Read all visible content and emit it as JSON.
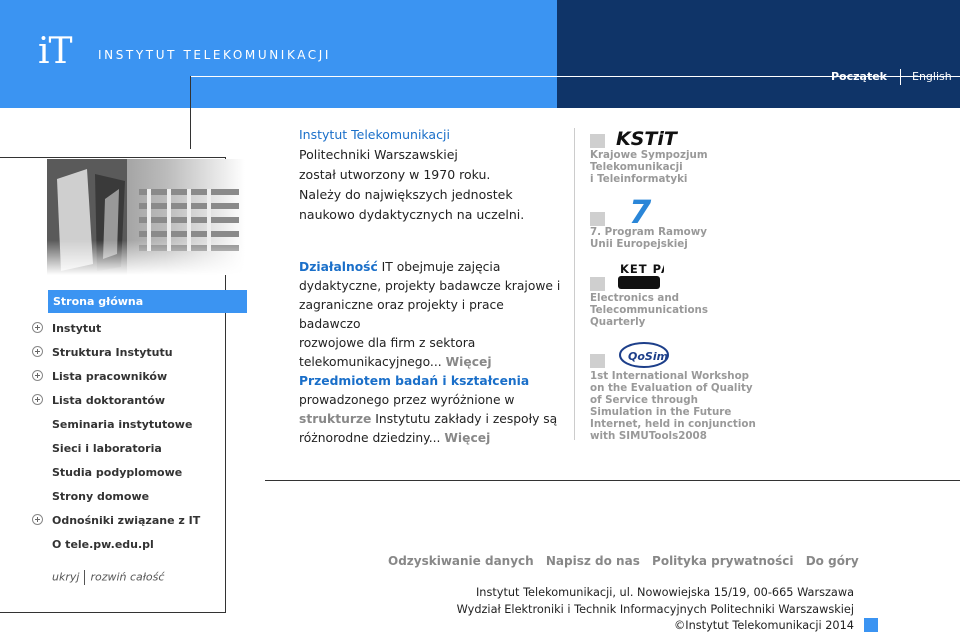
{
  "header": {
    "logo_mark": "iT",
    "logo_text": "INSTYTUT TELEKOMUNIKACJI",
    "nav_active": "Początek",
    "nav_english": "English",
    "colors": {
      "header_blue": "#3b94f2",
      "header_navy": "#0f3468"
    }
  },
  "sidebar": {
    "active": "Strona główna",
    "items": [
      {
        "label": "Instytut",
        "expandable": true
      },
      {
        "label": "Struktura Instytutu",
        "expandable": true
      },
      {
        "label": "Lista pracowników",
        "expandable": true
      },
      {
        "label": "Lista doktorantów",
        "expandable": true
      },
      {
        "label": "Seminaria instytutowe",
        "expandable": false
      },
      {
        "label": "Sieci i laboratoria",
        "expandable": false
      },
      {
        "label": "Studia podyplomowe",
        "expandable": false
      },
      {
        "label": "Strony domowe",
        "expandable": false
      },
      {
        "label": "Odnośniki związane z IT",
        "expandable": true
      },
      {
        "label": "O tele.pw.edu.pl",
        "expandable": false
      }
    ],
    "collapse": "ukryj",
    "expand_all": "rozwiń całość"
  },
  "intro": {
    "lead": "Instytut Telekomunikacji",
    "line2": "Politechniki Warszawskiej",
    "line3": "został utworzony w 1970 roku.",
    "line4": "Należy do największych jednostek",
    "line5": "naukowo dydaktycznych na uczelni."
  },
  "activity": {
    "heading": "Działalność",
    "text_1": " IT obejmuje zajęcia",
    "text_2": "dydaktyczne, projekty badawcze krajowe i",
    "text_3": "zagraniczne oraz projekty i prace badawczo",
    "text_4": "rozwojowe dla firm z sektora",
    "text_5": "telekomunikacyjnego...",
    "more": "Więcej"
  },
  "research": {
    "heading": "Przedmiotem badań i kształcenia",
    "text_1": "prowadzonego przez wyróżnione w",
    "grey": "strukturze",
    "text_2": " Instytutu zakłady i zespoły są",
    "text_3": "różnorodne dziedziny...",
    "more": "Więcej"
  },
  "rail": [
    {
      "logo": "KSTiT",
      "lines": [
        "Krajowe Sympozjum",
        "Telekomunikacji",
        "i Teleinformatyki"
      ]
    },
    {
      "logo": "7",
      "lines": [
        "7. Program Ramowy",
        "Unii Europejskiej"
      ]
    },
    {
      "logo": "KET PAN",
      "lines": [
        "Electronics and",
        "Telecommunications",
        "Quarterly"
      ]
    },
    {
      "logo": "QoSim",
      "lines": [
        "1st International Workshop",
        "on the Evaluation of Quality",
        "of Service through",
        "Simulation in the Future",
        "Internet, held in conjunction",
        "with SIMUTools2008"
      ]
    }
  ],
  "footer": {
    "links": [
      "Odzyskiwanie danych",
      "Napisz do nas",
      "Polityka prywatności",
      "Do góry"
    ],
    "address_1": "Instytut Telekomunikacji, ul. Nowowiejska 15/19, 00-665 Warszawa",
    "address_2": "Wydział Elektroniki i Technik Informacyjnych Politechniki Warszawskiej",
    "copyright": "©Instytut Telekomunikacji 2014"
  }
}
